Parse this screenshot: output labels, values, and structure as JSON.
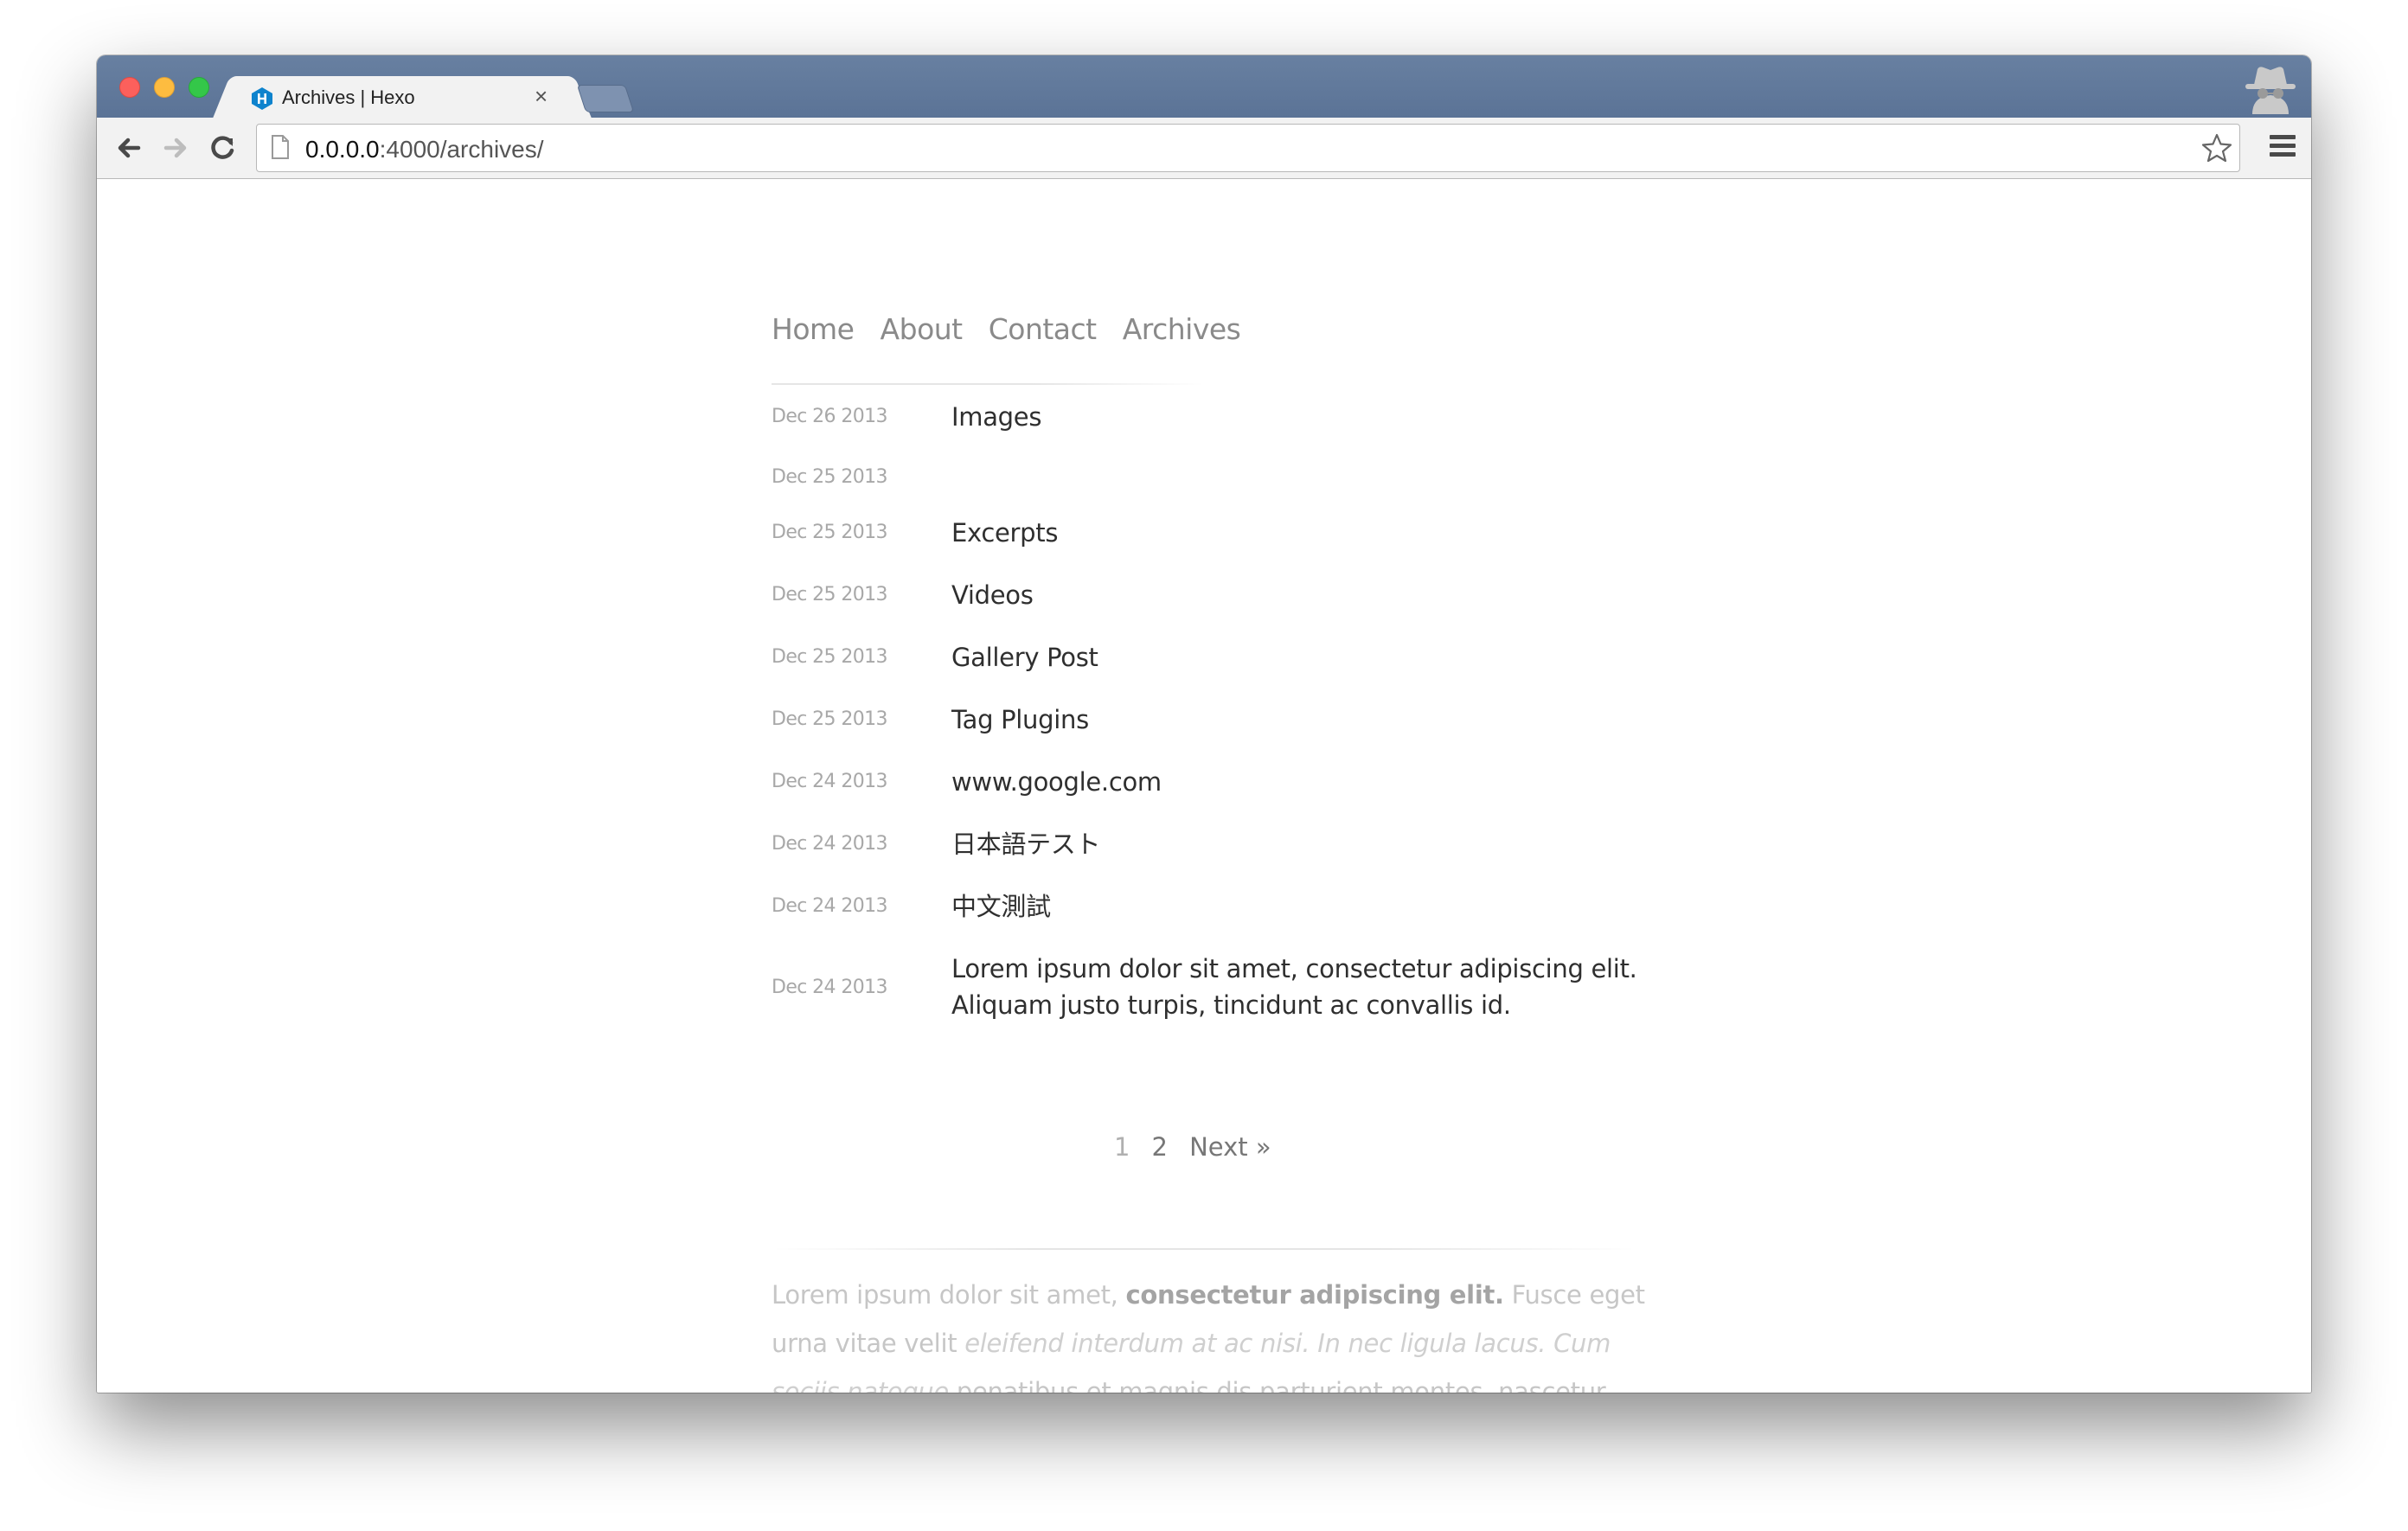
{
  "browser": {
    "tab_title": "Archives | Hexo",
    "tab_close": "×",
    "url_host": "0.0.0.0",
    "url_rest": ":4000/archives/"
  },
  "site": {
    "nav": [
      "Home",
      "About",
      "Contact",
      "Archives"
    ]
  },
  "archive": {
    "posts": [
      {
        "date": "Dec 26 2013",
        "title": "Images"
      },
      {
        "date": "Dec 25 2013",
        "title": ""
      },
      {
        "date": "Dec 25 2013",
        "title": "Excerpts"
      },
      {
        "date": "Dec 25 2013",
        "title": "Videos"
      },
      {
        "date": "Dec 25 2013",
        "title": "Gallery Post"
      },
      {
        "date": "Dec 25 2013",
        "title": "Tag Plugins"
      },
      {
        "date": "Dec 24 2013",
        "title": "www.google.com"
      },
      {
        "date": "Dec 24 2013",
        "title": "日本語テスト"
      },
      {
        "date": "Dec 24 2013",
        "title": "中文測試"
      },
      {
        "date": "Dec 24 2013",
        "title": "Lorem ipsum dolor sit amet, consectetur adipiscing elit. Aliquam justo turpis, tincidunt ac convallis id."
      }
    ]
  },
  "pagination": {
    "current": "1",
    "page2": "2",
    "next": "Next »"
  },
  "footer": {
    "p1": "Lorem ipsum dolor sit amet,",
    "p2_bold": "consectetur adipiscing elit.",
    "p3": "Fusce eget urna vitae velit",
    "p4_italic": "eleifend interdum at ac nisi. In nec ligula lacus. Cum sociis natoque",
    "p5": "penatibus et magnis dis parturient montes, nascetur ridiculus mus. Sed eu cursus erat, ut dapibus quam. Archive"
  },
  "colors": {
    "titlebar": "#5b7396",
    "nav_text": "#8a8a8a",
    "title_text": "#2f2f2f",
    "date_text": "#a8a8a8",
    "hexo_blue": "#0e83cd"
  }
}
